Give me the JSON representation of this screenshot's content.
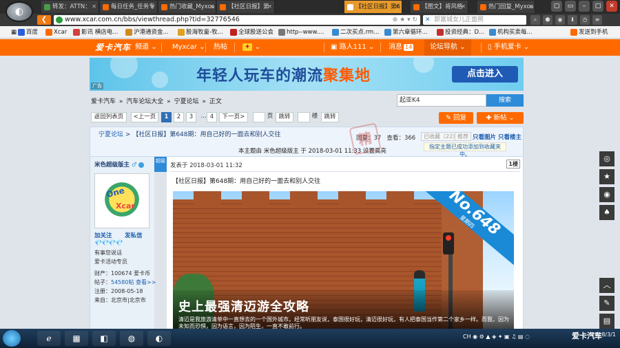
{
  "browser": {
    "tabs": [
      {
        "title": "转发：ATTN：",
        "color": "#4a9a4a"
      },
      {
        "title": "每日任务_任务专",
        "color": "#ff6a00"
      },
      {
        "title": "热门收藏_Myxca",
        "color": "#ff6a00"
      },
      {
        "title": "【社区日报】第",
        "color": "#ff6a00"
      },
      {
        "title": "【社区日报】第6",
        "color": "#ff6a00",
        "active": true
      },
      {
        "title": "【图文】将风格",
        "color": "#ff6a00"
      },
      {
        "title": "热门回复_Myxca",
        "color": "#ff6a00"
      }
    ],
    "url": "www.xcar.com.cn/bbs/viewthread.php?tid=32776546",
    "search_placeholder": "郭富城女儿正面照",
    "bookmarks": [
      {
        "label": "百度",
        "color": "#2a5fd8"
      },
      {
        "label": "Xcar",
        "color": "#ff6a00"
      },
      {
        "label": "影讯 横店电...",
        "color": "#d04040"
      },
      {
        "label": "沪港通资金...",
        "color": "#d08a20"
      },
      {
        "label": "股海牧童-牧...",
        "color": "#e0a020"
      },
      {
        "label": "全球股送公会",
        "color": "#c02020"
      },
      {
        "label": "http--www....",
        "color": "#777"
      },
      {
        "label": "二次买点.rm...",
        "color": "#3a8ad0"
      },
      {
        "label": "第六章循环...",
        "color": "#3a8ad0"
      },
      {
        "label": "投资经典：D...",
        "color": "#c03030"
      },
      {
        "label": "机构买卖每...",
        "color": "#3a8ad0"
      }
    ],
    "send_phone": "发送到手机"
  },
  "site_nav": {
    "logo": "爱卡汽车",
    "items": [
      "频道",
      "Myxcar",
      "热帖"
    ],
    "user": "路人111",
    "messages_label": "消息",
    "messages_count": "14",
    "forum_nav": "论坛导航",
    "mobile": "手机爱卡"
  },
  "banner": {
    "text_a": "年轻人",
    "text_b": "玩车的潮流",
    "text_c": "聚集地",
    "button": "点击进入",
    "ad_tag": "广告"
  },
  "breadcrumb": [
    "爱卡汽车",
    "»",
    "汽车论坛大全",
    "»",
    "宁夏论坛",
    "»",
    "正文"
  ],
  "search": {
    "value": "起亚K4",
    "button": "搜索"
  },
  "pager": {
    "back": "返回列表页",
    "prev": "上一页",
    "pages": [
      "1",
      "2",
      "3",
      "...",
      "4"
    ],
    "next": "下一页",
    "page_unit": "页",
    "jump": "跳转",
    "floor_unit": "楼",
    "jump2": "跳转"
  },
  "actions": {
    "reply": "回复",
    "new_post": "新帖"
  },
  "thread": {
    "forum": "宁夏论坛",
    "title": "【社区日报】第648期：用自己好的一面去和别人交往",
    "replies_label": "回复：",
    "replies": "37",
    "views_label": "查看：",
    "views": "366",
    "collected": "已收藏（22）",
    "recommend": "推荐",
    "only_images": "只看图片",
    "only_author": "只看楼主",
    "tip": "指定主题已成功添加到收藏夹中。",
    "meta": "本主题由 米色超级版主 于 2018-03-01 11:33 设置高亮"
  },
  "author": {
    "name": "米色超级版主",
    "follow": "加关注",
    "message": "发私信",
    "gems": "💎💎💎💎",
    "motto": "有事您说话",
    "role": "爱卡活动专员",
    "assets_label": "财产：",
    "assets": "100674 爱卡币",
    "posts_label": "帖子：",
    "posts": "54580帖",
    "view": "查看>>",
    "reg_label": "注册：",
    "reg": "2008-05-18",
    "from_label": "来自：",
    "from": "北京市|北京市"
  },
  "post": {
    "flag": "超级",
    "posted": "发表于 2018-03-01 11:32",
    "floor": "1楼",
    "title": "【社区日报】第648期：用自己好的一面去和别人交往",
    "ribbon_num": "No.648",
    "ribbon_day": "星期四",
    "hero_title": "史上最强清迈游全攻略",
    "hero_text": "清迈是我旅游清单中一直想去的一个国外城市。经常听朋友说，泰国很好玩，清迈很好玩，有人把泰国当作第二个家乡一样。而我，因为未知而恐惧，因为语言，因为陌生，一直不敢前行。"
  },
  "taskbar": {
    "tray": "CH",
    "watermark": "爱卡汽车",
    "date": "2018/3/1"
  }
}
